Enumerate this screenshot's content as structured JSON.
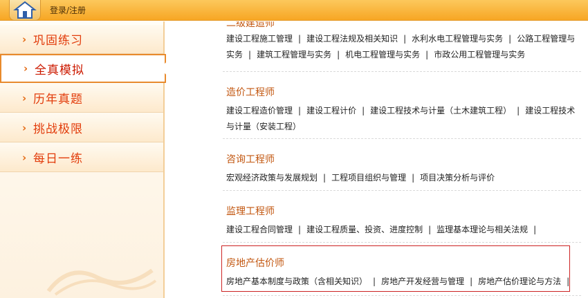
{
  "topbar": {
    "home_icon": "house-icon",
    "login_text": "登录/注册"
  },
  "sidebar": {
    "items": [
      {
        "label": "巩固练习",
        "active": false
      },
      {
        "label": "全真模拟",
        "active": true
      },
      {
        "label": "历年真题",
        "active": false
      },
      {
        "label": "挑战极限",
        "active": false
      },
      {
        "label": "每日一练",
        "active": false
      }
    ],
    "arrow_glyph": "›"
  },
  "content": {
    "partial_title": "二级建造师",
    "sections": [
      {
        "title": "",
        "links": [
          "建设工程施工管理",
          "建设工程法规及相关知识",
          "水利水电工程管理与实务",
          "公路工程管理与实务",
          "建筑工程管理与实务",
          "机电工程管理与实务",
          "市政公用工程管理与实务"
        ]
      },
      {
        "title": "造价工程师",
        "links": [
          "建设工程造价管理",
          "建设工程计价",
          "建设工程技术与计量（土木建筑工程）",
          "建设工程技术与计量（安装工程）"
        ]
      },
      {
        "title": "咨询工程师",
        "links": [
          "宏观经济政策与发展规划",
          "工程项目组织与管理",
          "项目决策分析与评价"
        ]
      },
      {
        "title": "监理工程师",
        "links": [
          "建设工程合同管理",
          "建设工程质量、投资、进度控制",
          "监理基本理论与相关法规"
        ]
      },
      {
        "title": "房地产估价师",
        "links": [
          "房地产基本制度与政策（含相关知识）",
          "房地产开发经营与管理",
          "房地产估价理论与方法"
        ]
      }
    ],
    "separator": "|"
  },
  "colors": {
    "accent": "#e23c0b",
    "title": "#c2560f",
    "topbar": "#f7a624",
    "highlight": "#cc2222"
  }
}
